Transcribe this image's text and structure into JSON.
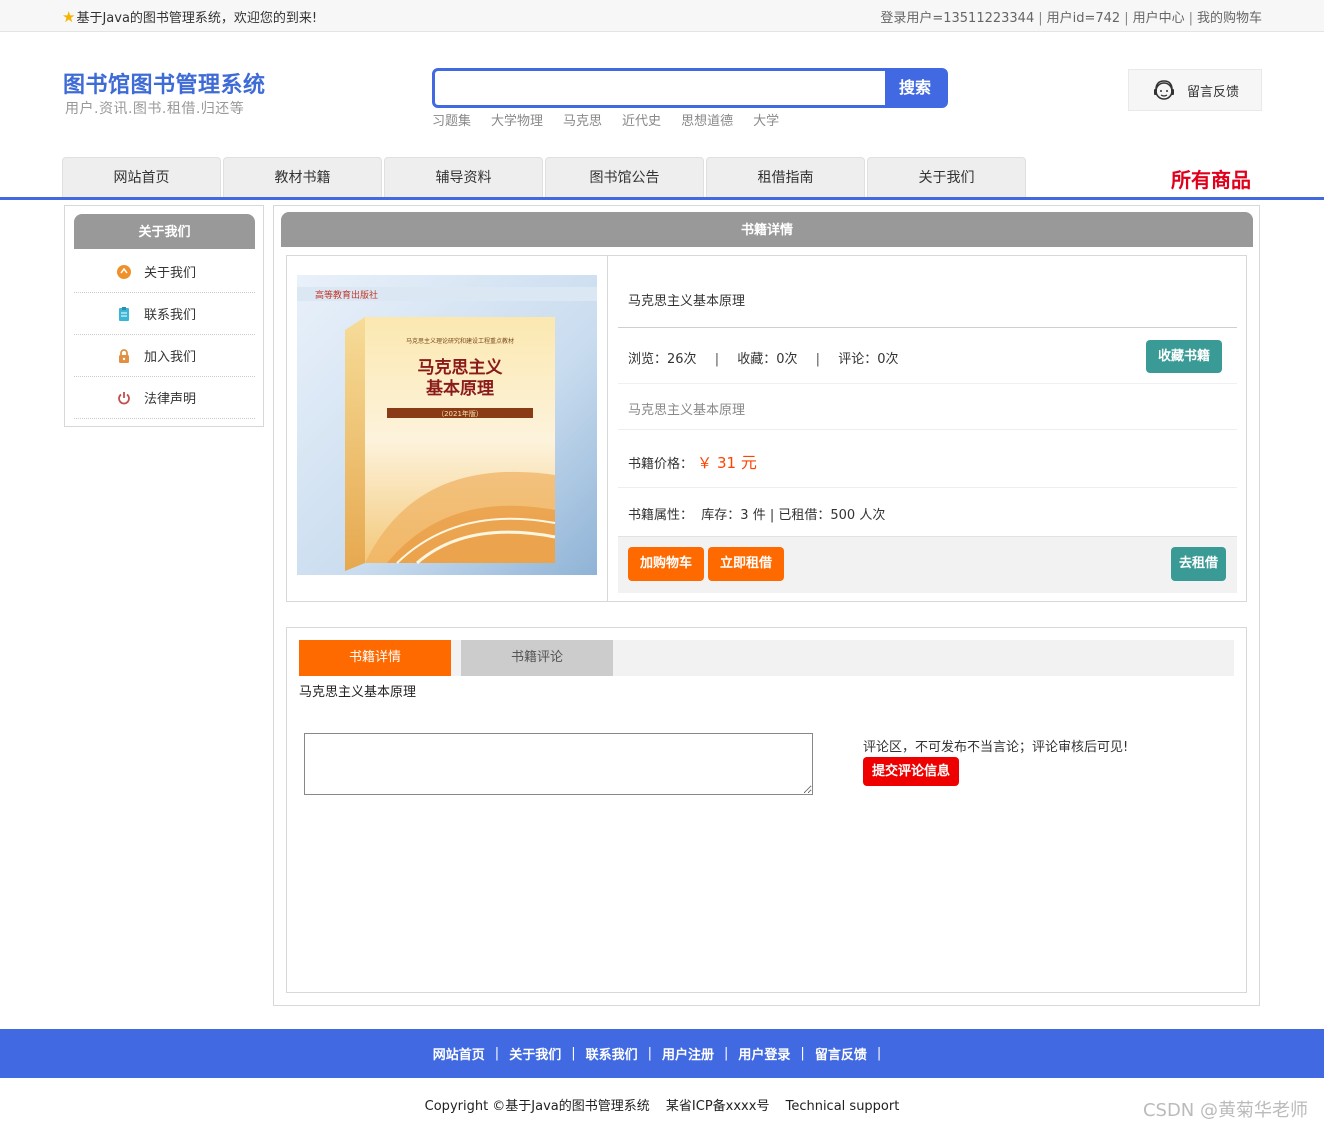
{
  "topbar": {
    "welcome": "基于Java的图书管理系统，欢迎您的到来!",
    "login_user": "登录用户=13511223344",
    "user_id": "用户id=742",
    "user_center": "用户中心",
    "cart": "我的购物车"
  },
  "header": {
    "title": "图书馆图书管理系统",
    "subtitle": "用户.资讯.图书.租借.归还等",
    "search_button": "搜索",
    "search_value": "",
    "hotwords": [
      "习题集",
      "大学物理",
      "马克思",
      "近代史",
      "思想道德",
      "大学"
    ],
    "feedback": "留言反馈"
  },
  "nav": {
    "items": [
      "网站首页",
      "教材书籍",
      "辅导资料",
      "图书馆公告",
      "租借指南",
      "关于我们"
    ],
    "all_goods": "所有商品"
  },
  "sidebar": {
    "title": "关于我们",
    "items": [
      {
        "label": "关于我们",
        "icon": "about-icon",
        "color": "#f0902a"
      },
      {
        "label": "联系我们",
        "icon": "clipboard-icon",
        "color": "#3bb6d6"
      },
      {
        "label": "加入我们",
        "icon": "lock-icon",
        "color": "#e09040"
      },
      {
        "label": "法律声明",
        "icon": "power-icon",
        "color": "#c0504d"
      }
    ]
  },
  "detail": {
    "panel_title": "书籍详情",
    "cover": {
      "publisher": "高等教育出版社",
      "series": "马克思主义理论研究和建设工程重点教材",
      "title_line1": "马克思主义",
      "title_line2": "基本原理",
      "edition": "（2021年版）"
    },
    "book_name": "马克思主义基本原理",
    "views_label": "浏览：",
    "views": "26次",
    "favorites_label": "收藏：",
    "favorites": "0次",
    "comments_label": "评论：",
    "comments": "0次",
    "favorite_button": "收藏书籍",
    "subtitle": "马克思主义基本原理",
    "price_label": "书籍价格：",
    "price_symbol": "￥",
    "price": "31",
    "price_unit": "元",
    "attr_label": "书籍属性：",
    "stock_label": "库存：",
    "stock": "3 件",
    "rented_label": "已租借：",
    "rented": "500 人次",
    "add_cart_button": "加购物车",
    "rent_now_button": "立即租借",
    "go_rent_button": "去租借"
  },
  "tabs": {
    "active": "书籍详情",
    "inactive": "书籍评论",
    "content": "马克思主义基本原理",
    "comment_placeholder": "",
    "comment_note": "评论区，不可发布不当言论；评论审核后可见!",
    "submit_button": "提交评论信息"
  },
  "footer": {
    "links": [
      "网站首页",
      "关于我们",
      "联系我们",
      "用户注册",
      "用户登录",
      "留言反馈"
    ],
    "copyright": "Copyright ©基于Java的图书管理系统",
    "icp": "某省ICP备xxxx号",
    "support": "Technical support",
    "watermark": "CSDN @黄菊华老师"
  },
  "colors": {
    "brand_blue": "#4169e1",
    "orange": "#ff6a00",
    "teal": "#3a9a96",
    "red": "#ee0000",
    "price": "#ff4400"
  }
}
